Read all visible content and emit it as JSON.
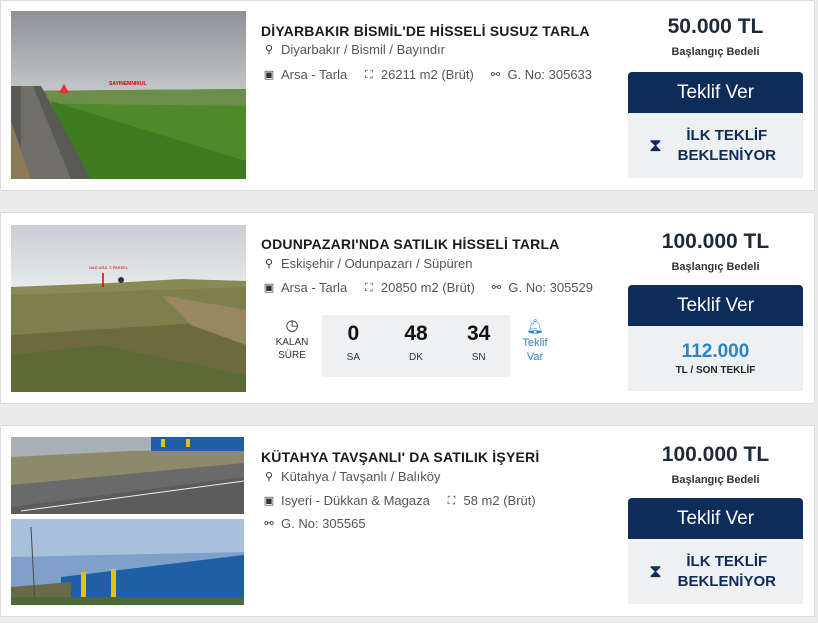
{
  "listings": [
    {
      "title": "DİYARBAKIR BİSMİL'DE HİSSELİ SUSUZ TARLA",
      "location": "Diyarbakır / Bismil / Bayındır",
      "type": "Arsa - Tarla",
      "area": "26211 m2 (Brüt)",
      "gno": "G. No: 305633",
      "price": "50.000 TL",
      "price_label": "Başlangıç Bedeli",
      "button": "Teklif Ver",
      "status": "İLK TEKLİF BEKLENİYOR",
      "image_sign": "SAYINEMNIKUL"
    },
    {
      "title": "ODUNPAZARI'NDA SATILIK HİSSELİ TARLA",
      "location": "Eskişehir / Odunpazarı / Süpüren",
      "type": "Arsa - Tarla",
      "area": "20850 m2 (Brüt)",
      "gno": "G. No: 305529",
      "price": "100.000 TL",
      "price_label": "Başlangıç Bedeli",
      "button": "Teklif Ver",
      "last_bid": "112.000",
      "last_bid_label": "TL / SON TEKLİF",
      "timer": {
        "label_line1": "KALAN",
        "label_line2": "SÜRE",
        "hours": "0",
        "hours_unit": "SA",
        "minutes": "48",
        "minutes_unit": "DK",
        "seconds": "34",
        "seconds_unit": "SN"
      },
      "bid_indicator_line1": "Teklif",
      "bid_indicator_line2": "Var",
      "image_sign": "NILE ARA. 3 PARSEL"
    },
    {
      "title": "KÜTAHYA TAVŞANLI' DA SATILIK İŞYERİ",
      "location": "Kütahya / Tavşanlı / Balıköy",
      "type": "Isyeri - Dükkan & Magaza",
      "area": "58 m2 (Brüt)",
      "gno": "G. No: 305565",
      "price": "100.000 TL",
      "price_label": "Başlangıç Bedeli",
      "button": "Teklif Ver",
      "status": "İLK TEKLİF BEKLENİYOR"
    }
  ],
  "icons": {
    "location": "map-pin-icon",
    "type": "store-icon",
    "area": "area-icon",
    "gno": "gno-icon",
    "status": "hourglass-icon",
    "timer": "clock-icon",
    "bid": "bell-icon"
  },
  "colors": {
    "button_bg": "#0e2c5a",
    "bid_value": "#2b83c6",
    "status_bg": "#eef0f2"
  }
}
